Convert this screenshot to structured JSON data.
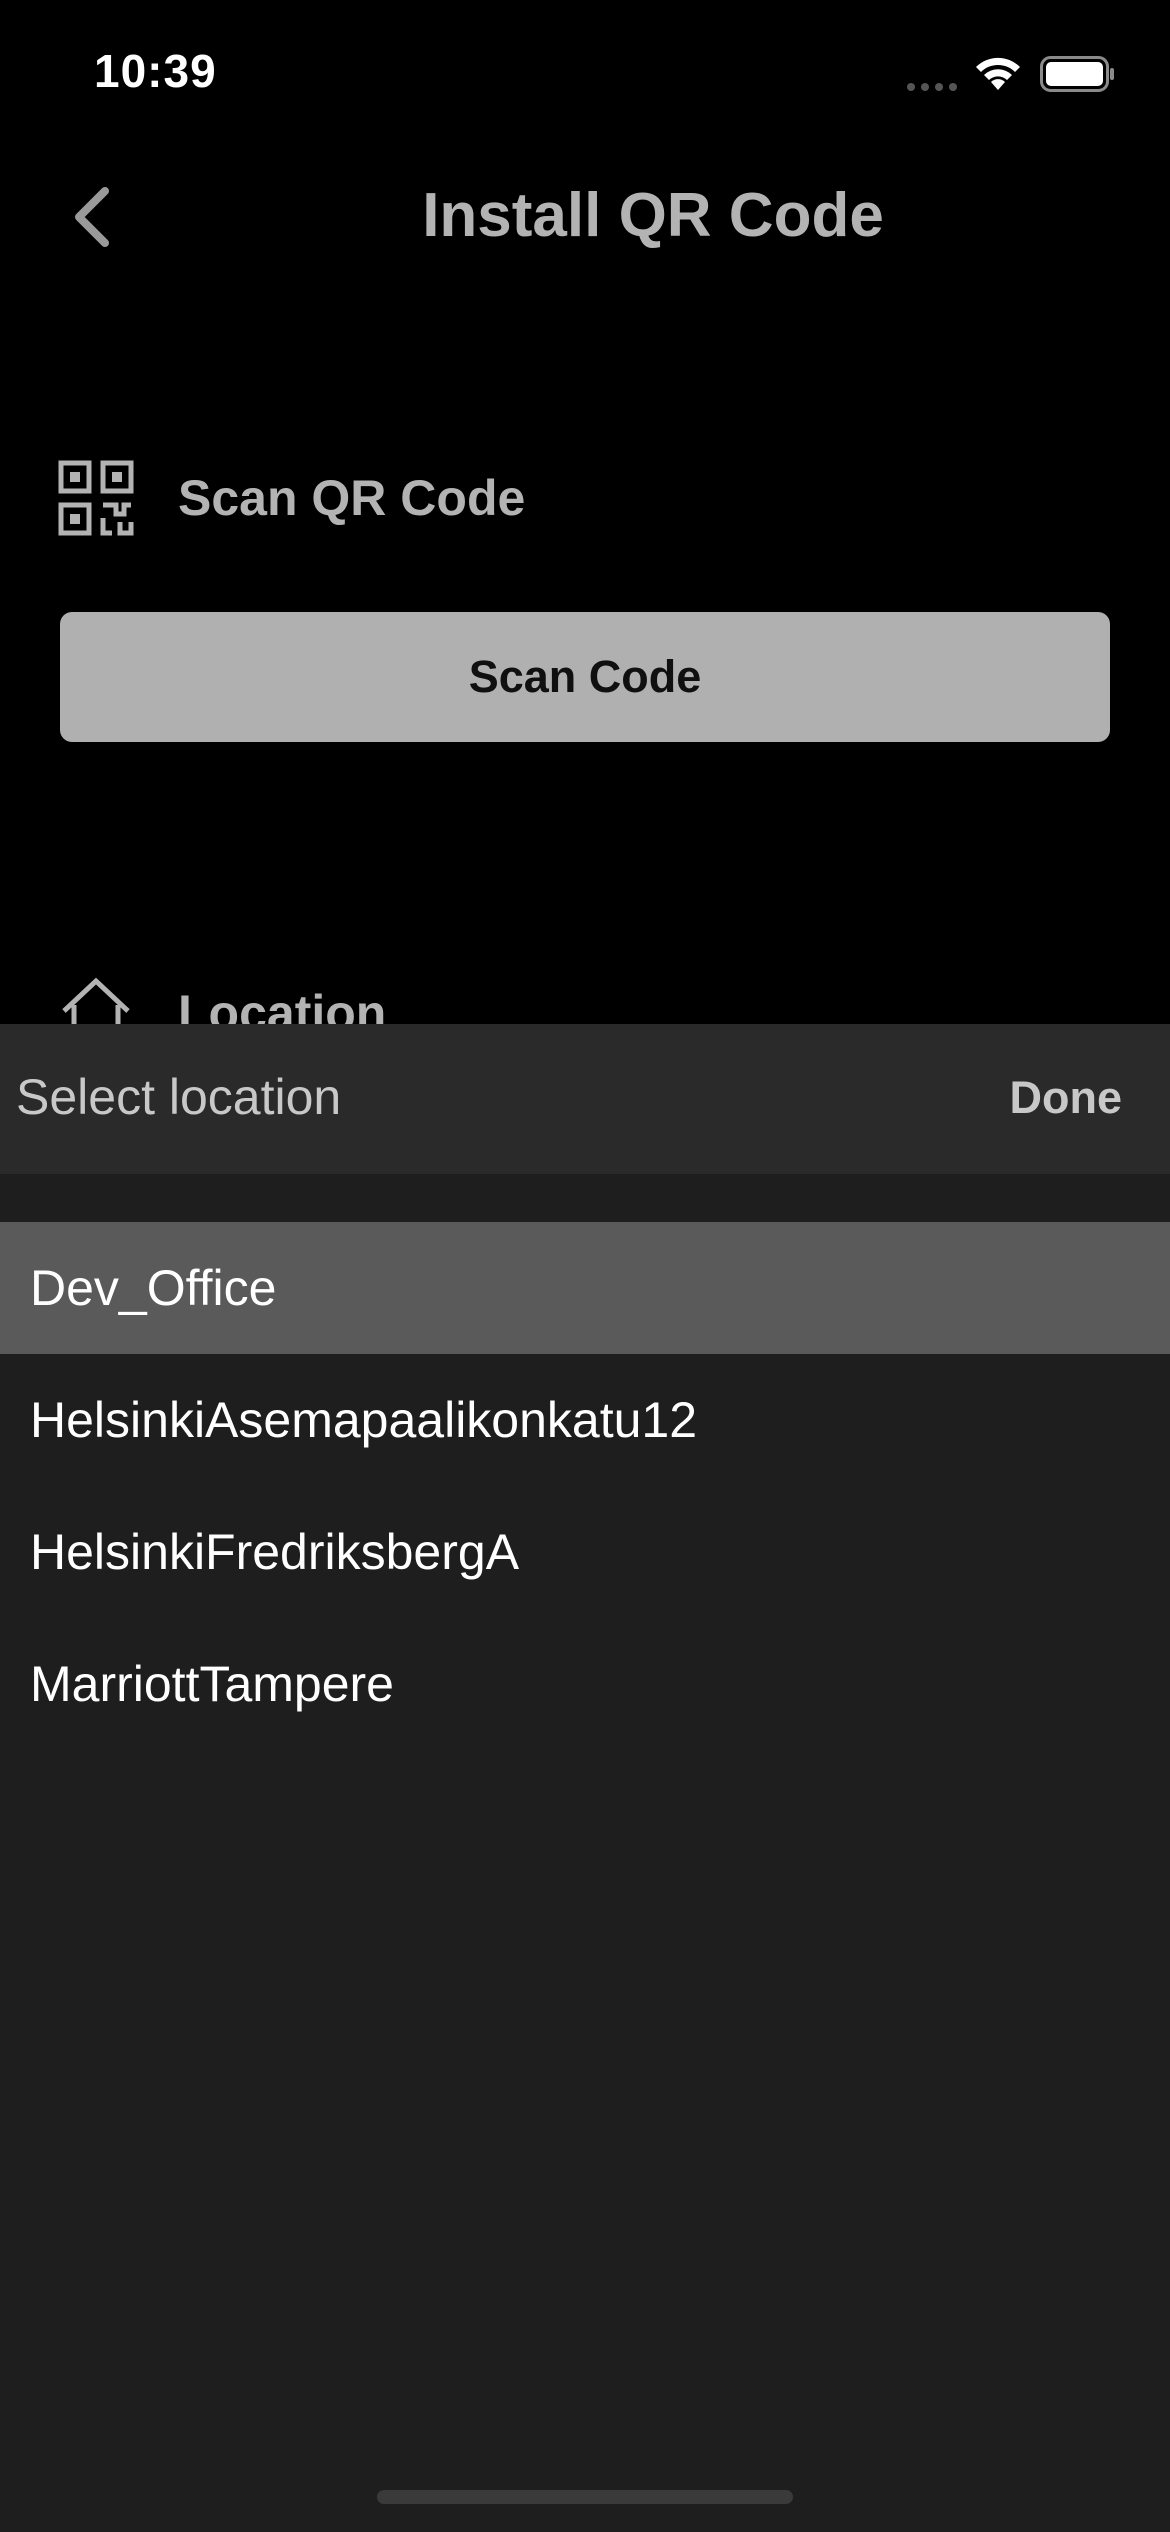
{
  "status_bar": {
    "time": "10:39"
  },
  "nav": {
    "title": "Install QR Code",
    "back_icon": "chevron-left-icon"
  },
  "scan_section": {
    "icon": "qr-code-icon",
    "label": "Scan QR Code",
    "button_label": "Scan Code"
  },
  "location_section": {
    "icon": "home-icon",
    "label": "Location"
  },
  "picker": {
    "title": "Select location",
    "done_label": "Done",
    "options": [
      {
        "label": "Dev_Office",
        "selected": true
      },
      {
        "label": "HelsinkiAsemapaalikonkatu12",
        "selected": false
      },
      {
        "label": "HelsinkiFredriksbergA",
        "selected": false
      },
      {
        "label": "MarriottTampere",
        "selected": false
      }
    ]
  },
  "colors": {
    "background": "#000000",
    "sheet_background": "#1e1e1e",
    "toolbar_background": "#2a2a2a",
    "selected_row": "#5a5a5a",
    "button_background": "#b0b0b0",
    "muted_text": "#b3b3b3"
  }
}
